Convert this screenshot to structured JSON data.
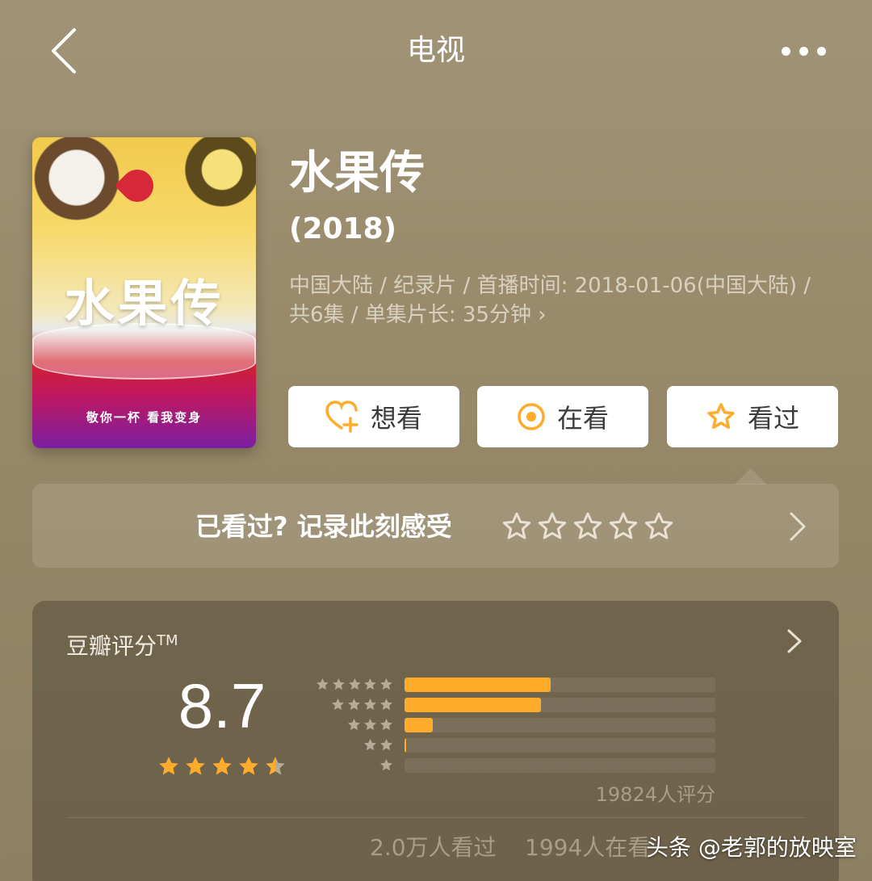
{
  "header": {
    "title": "电视"
  },
  "poster": {
    "logo_text": "水果传",
    "slogan": "敬你一杯  看我变身"
  },
  "info": {
    "title": "水果传",
    "year": "(2018)",
    "meta": "中国大陆 / 纪录片 / 首播时间: 2018-01-06(中国大陆) / 共6集 / 单集片长: 35分钟 ›"
  },
  "actions": {
    "want_label": "想看",
    "watching_label": "在看",
    "watched_label": "看过"
  },
  "rate_prompt": {
    "text": "已看过? 记录此刻感受",
    "star_count": 5
  },
  "douban": {
    "title": "豆瓣评分",
    "trademark": "TM",
    "score": "8.7",
    "score_stars": 4.5,
    "distribution": [
      {
        "stars": 5,
        "fraction": 0.47
      },
      {
        "stars": 4,
        "fraction": 0.44
      },
      {
        "stars": 3,
        "fraction": 0.09
      },
      {
        "stars": 2,
        "fraction": 0.005
      },
      {
        "stars": 1,
        "fraction": 0.0
      }
    ],
    "rating_count": "19824人评分",
    "watched": "2.0万人看过",
    "watching": "1994人在看"
  },
  "watermark": "头条 @老郭的放映室",
  "colors": {
    "accent": "#ffac2d",
    "star_gray": "#b5ab98"
  }
}
